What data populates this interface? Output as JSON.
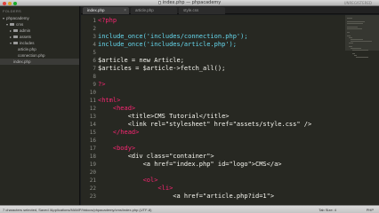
{
  "window": {
    "title": "index.php — phpacademy",
    "unregistered": "UNREGISTERED"
  },
  "sidebar": {
    "header": "FOLDERS",
    "items": [
      {
        "label": "phpacademy",
        "kind": "folder",
        "expanded": true
      },
      {
        "label": "cms",
        "kind": "folder",
        "expanded": true
      },
      {
        "label": "admin",
        "kind": "folder",
        "expanded": false
      },
      {
        "label": "assets",
        "kind": "folder",
        "expanded": false
      },
      {
        "label": "includes",
        "kind": "folder",
        "expanded": true
      },
      {
        "label": "article.php",
        "kind": "file"
      },
      {
        "label": "connection.php",
        "kind": "file"
      },
      {
        "label": "index.php",
        "kind": "file",
        "selected": true
      }
    ]
  },
  "tabs": [
    {
      "label": "index.php",
      "active": true
    },
    {
      "label": "article.php",
      "active": false
    },
    {
      "label": "style.css",
      "active": false
    }
  ],
  "editor": {
    "lines": [
      {
        "n": "1",
        "text": "<?php"
      },
      {
        "n": "2",
        "text": ""
      },
      {
        "n": "3",
        "text": "include_once('includes/connection.php');"
      },
      {
        "n": "4",
        "text": "include_once('includes/article.php');"
      },
      {
        "n": "5",
        "text": ""
      },
      {
        "n": "6",
        "text": "$article = new Article;"
      },
      {
        "n": "7",
        "text": "$articles = $article->fetch_all();"
      },
      {
        "n": "8",
        "text": ""
      },
      {
        "n": "9",
        "text": "?>"
      },
      {
        "n": "10",
        "text": ""
      },
      {
        "n": "11",
        "text": "<html>"
      },
      {
        "n": "12",
        "text": "    <head>"
      },
      {
        "n": "13",
        "text": "        <title>CMS Tutorial</title>"
      },
      {
        "n": "14",
        "text": "        <link rel=\"stylesheet\" href=\"assets/style.css\" />"
      },
      {
        "n": "15",
        "text": "    </head>"
      },
      {
        "n": "16",
        "text": ""
      },
      {
        "n": "17",
        "text": "    <body>"
      },
      {
        "n": "18",
        "text": "        <div class=\"container\">"
      },
      {
        "n": "19",
        "text": "            <a href=\"index.php\" id=\"logo\">CMS</a>"
      },
      {
        "n": "20",
        "text": ""
      },
      {
        "n": "21",
        "text": "            <ol>"
      },
      {
        "n": "22",
        "text": "                <li>"
      },
      {
        "n": "23",
        "text": "                    <a href=\"article.php?id=1\">"
      }
    ]
  },
  "statusbar": {
    "left": "7 characters selected, Saved /Applications/MAMP/htdocs/phpacademy/cms/index.php (UTF-8)",
    "tab_size": "Tab Size: 4",
    "syntax": "PHP"
  }
}
